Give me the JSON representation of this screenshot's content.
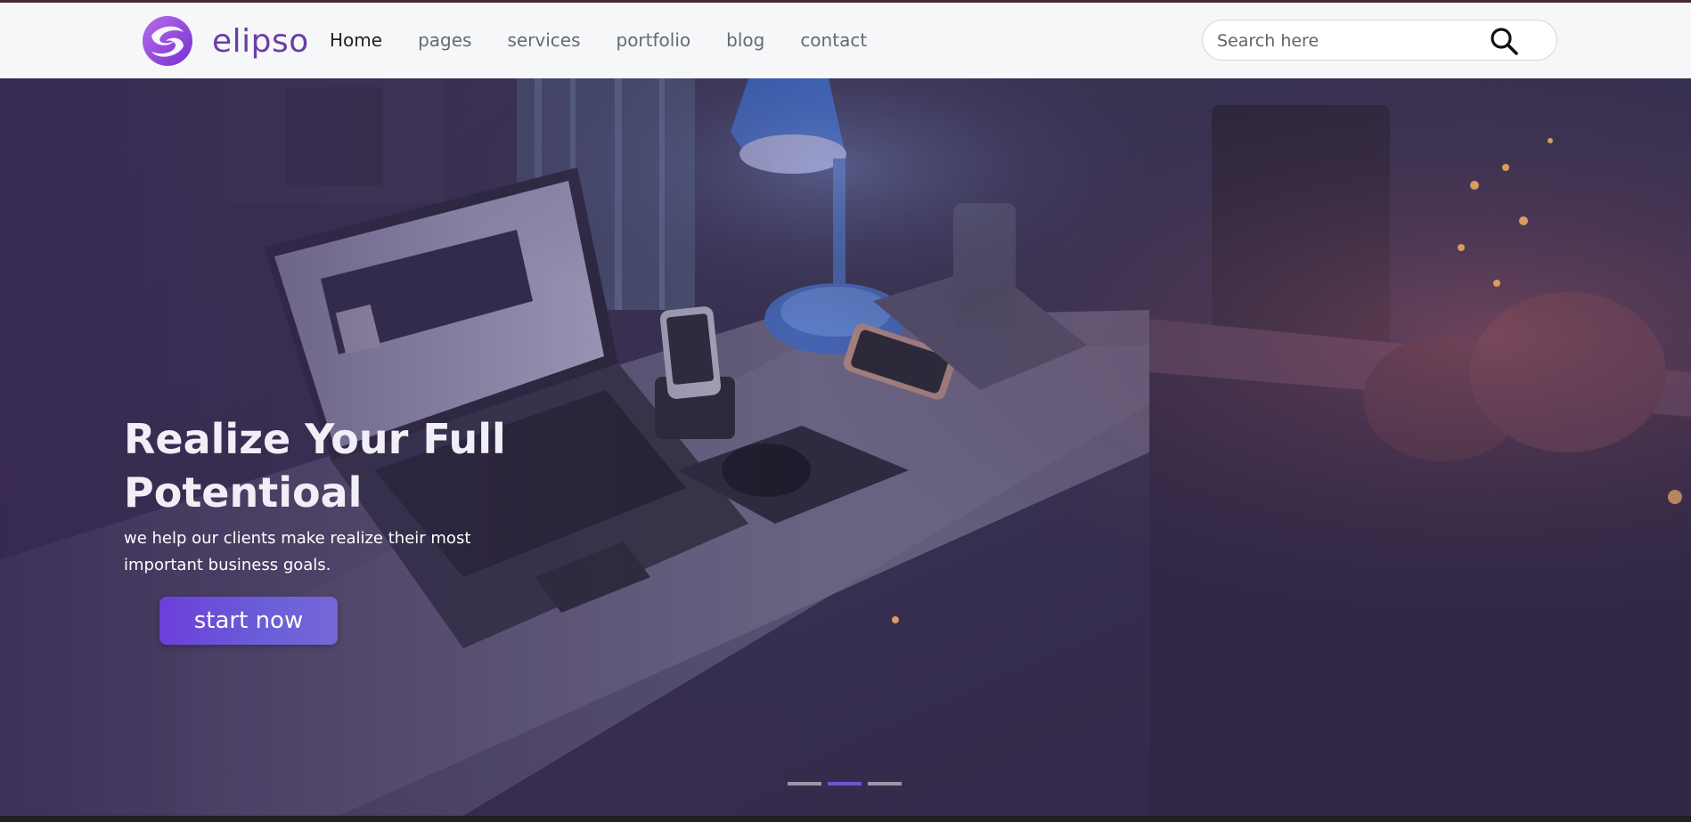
{
  "brand": {
    "name": "elipso",
    "logo_icon": "swirl-logo-icon",
    "color": "#6a3ea8"
  },
  "nav": {
    "items": [
      {
        "label": "Home",
        "active": true
      },
      {
        "label": "pages",
        "active": false
      },
      {
        "label": "services",
        "active": false
      },
      {
        "label": "portfolio",
        "active": false
      },
      {
        "label": "blog",
        "active": false
      },
      {
        "label": "contact",
        "active": false
      }
    ]
  },
  "search": {
    "placeholder": "Search here",
    "value": "",
    "icon": "search-icon"
  },
  "hero": {
    "title_line1": "Realize Your Full",
    "title_line2": "Potentioal",
    "subtitle_line1": "we help our clients make realize their most",
    "subtitle_line2": "important business goals.",
    "cta_label": "start now",
    "background": "desk-laptop-lamp-photo",
    "overlay_color": "#3b3452",
    "accent_color": "#6d3fd9"
  },
  "carousel": {
    "slide_count": 3,
    "active_index": 1
  }
}
